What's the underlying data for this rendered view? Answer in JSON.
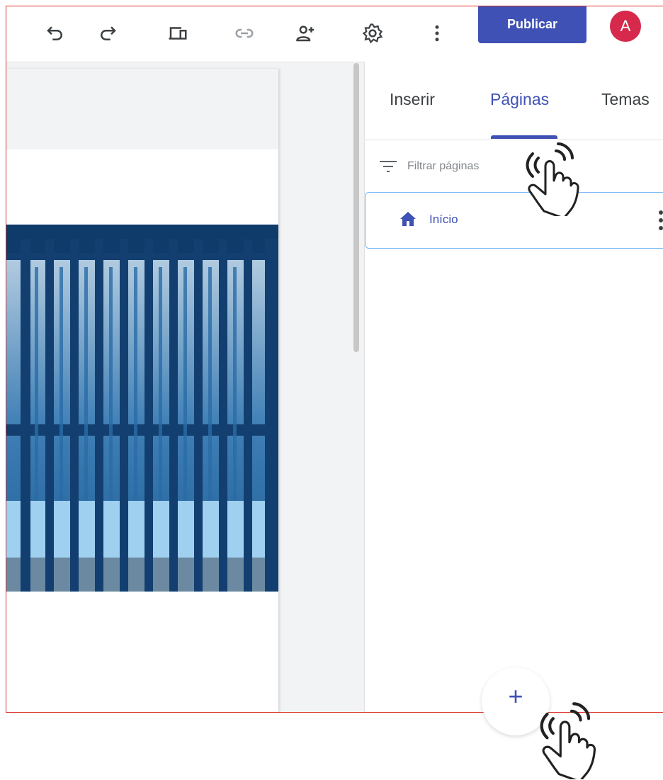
{
  "toolbar": {
    "icons": [
      "undo-icon",
      "redo-icon",
      "preview-devices-icon",
      "link-icon",
      "share-add-person-icon",
      "settings-gear-icon",
      "more-vert-icon"
    ],
    "publish_label": "Publicar",
    "avatar_initial": "A"
  },
  "panel": {
    "tabs": [
      {
        "label": "Inserir"
      },
      {
        "label": "Páginas"
      },
      {
        "label": "Temas"
      }
    ],
    "active_tab": "Páginas",
    "filter_placeholder": "Filtrar páginas",
    "pages": [
      {
        "label": "Início",
        "icon": "home-icon"
      }
    ]
  },
  "fab_label": "+",
  "colors": {
    "accent": "#3f51b5",
    "avatar": "#d6294b",
    "frame_border": "#d93025",
    "selected_border": "#76b5f7"
  }
}
